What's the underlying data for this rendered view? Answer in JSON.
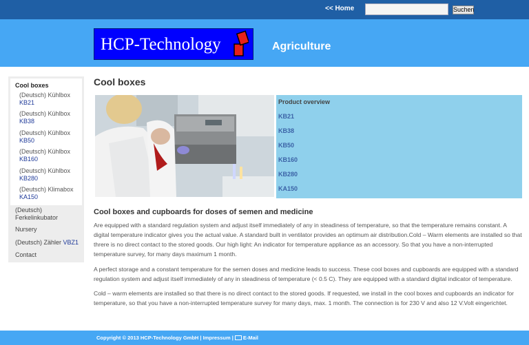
{
  "topbar": {
    "home_label": "<< Home",
    "search_placeholder": "",
    "search_button_label": "Suchen"
  },
  "header": {
    "logo_text": "HCP-Technology",
    "section_title": "Agriculture"
  },
  "sidebar": {
    "heading": "Cool boxes",
    "items": [
      {
        "prefix": "(Deutsch) Kühlbox",
        "code": "KB21"
      },
      {
        "prefix": "(Deutsch) Kühlbox",
        "code": "KB38"
      },
      {
        "prefix": "(Deutsch) Kühlbox",
        "code": "KB50"
      },
      {
        "prefix": "(Deutsch) Kühlbox",
        "code": "KB160"
      },
      {
        "prefix": "(Deutsch) Kühlbox",
        "code": "KB280"
      },
      {
        "prefix": "(Deutsch) Klimabox",
        "code": "KA150"
      }
    ],
    "outer_items": [
      {
        "line1": "(Deutsch)",
        "line2": "Ferkelinkubator"
      },
      {
        "label": "Nursery"
      },
      {
        "label": "(Deutsch) Zähler",
        "code": "VBZ1"
      },
      {
        "label": "Contact"
      }
    ]
  },
  "main": {
    "title": "Cool boxes",
    "product_overview": {
      "heading": "Product overview",
      "links": [
        "KB21",
        "KB38",
        "KB50",
        "KB160",
        "KB280",
        "KA150"
      ]
    },
    "subtitle": "Cool boxes and cupboards for doses of semen and medicine",
    "paragraphs": [
      "Are equipped with a standard regulation system and adjust itself immediately of any in steadiness of temperature, so that the temperature remains constant. A digital temperature indicator gives you the actual value. A standard built in ventilator provides an optimum air distribution.Cold – Warm elements are installed so that threre is no direct contact to the stored goods. Our high light: An indicator for temperature appliance as an accessory. So that you have a non-interrupted temperature survey, for many days maximum 1 month.",
      "A perfect storage and a constant temperature for the semen doses and medicine leads to success. These cool boxes and cupboards are equipped with a standard regulation system and adjust itself immediately of any in steadiness of temperature (< 0.5 C). They are equipped with a standard digital indicator of temperature.",
      "Cold – warm elements are installed so that there is no direct contact to the stored goods. If requested, we install in the cool boxes and cupboards an indicator for temperature, so that you have a non-interrupted temperature survey for many days, max. 1 month. The connection is for 230 V and also 12 V.Volt eingerichtet."
    ]
  },
  "footer": {
    "copyright": "Copyright © 2013 HCP-Technology GmbH",
    "sep1": " | ",
    "impressum": "Impressum",
    "sep2": " | ",
    "email": "E-Mail"
  },
  "colors": {
    "topbar": "#1f5fa5",
    "header": "#46a7f4",
    "logo_bg": "#0000ff",
    "logo_mark": "#e8201a",
    "product_box": "#8fd0ec",
    "link": "#3b62a6"
  }
}
